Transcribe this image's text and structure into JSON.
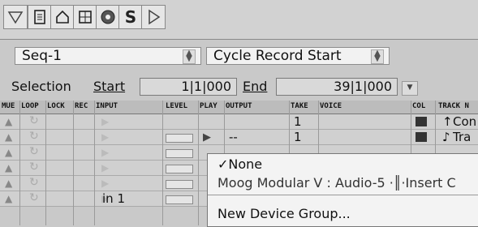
{
  "toolbar": {
    "buttons": [
      {
        "name": "triangle-down-icon"
      },
      {
        "name": "document-icon"
      },
      {
        "name": "home-icon"
      },
      {
        "name": "window-icon"
      },
      {
        "name": "color-wheel-icon"
      },
      {
        "name": "solo-icon",
        "label": "S"
      },
      {
        "name": "play-triangle-icon"
      }
    ]
  },
  "sequence": {
    "value": "Seq-1"
  },
  "record_mode": {
    "value": "Cycle Record Start"
  },
  "selection": {
    "label": "Selection",
    "start_label": "Start",
    "start_value": "1|1|000",
    "end_label": "End",
    "end_value": "39|1|000"
  },
  "columns": [
    "MUE",
    "LOOP",
    "LOCK",
    "REC",
    "INPUT",
    "LEVEL",
    "PLAY",
    "OUTPUT",
    "TAKE",
    "VOICE",
    "COL",
    "TRACK N"
  ],
  "rows": [
    {
      "output": "",
      "take": "1",
      "input": "",
      "track": "Con",
      "track_icon": "↑",
      "show_level": false,
      "show_play": false
    },
    {
      "output": "--",
      "take": "1",
      "input": "",
      "track": "Tra",
      "track_icon": "♪",
      "show_level": true,
      "show_play": true
    },
    {
      "output": "",
      "take": "",
      "input": "",
      "track": "",
      "track_icon": "",
      "show_level": true,
      "show_play": false
    },
    {
      "output": "",
      "take": "",
      "input": "",
      "track": "",
      "track_icon": "",
      "show_level": true,
      "show_play": false
    },
    {
      "output": "",
      "take": "",
      "input": "",
      "track": "",
      "track_icon": "",
      "show_level": true,
      "show_play": false
    },
    {
      "output": "",
      "take": "",
      "input": "in 1",
      "track": "",
      "track_icon": "",
      "show_level": true,
      "show_play": false
    }
  ],
  "menu": {
    "items": [
      {
        "label": "✓None"
      },
      {
        "label": "Moog Modular V : Audio-5 ·║·Insert C"
      },
      {
        "label": "New Device Group..."
      }
    ]
  }
}
